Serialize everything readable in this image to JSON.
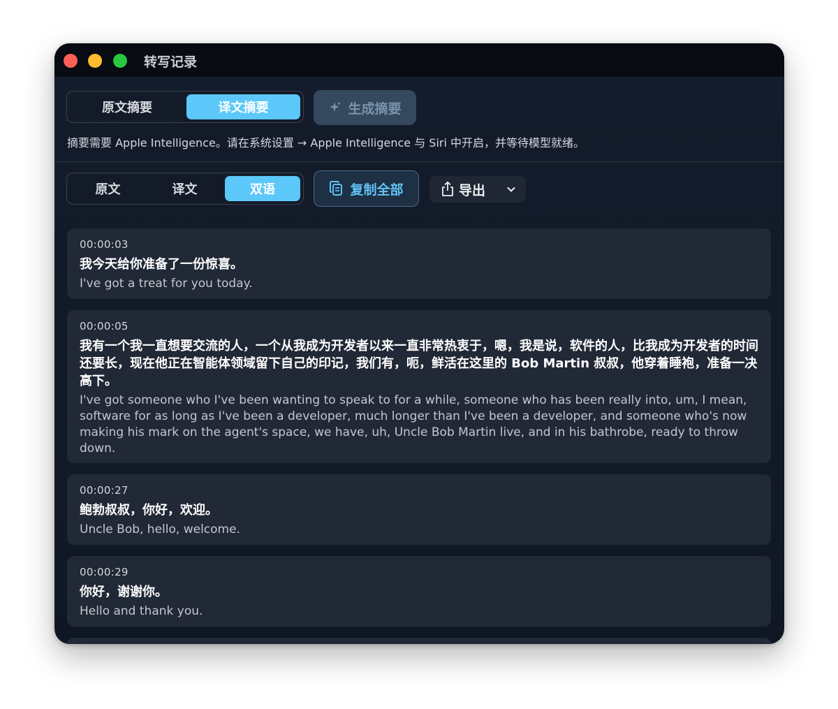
{
  "window": {
    "title": "转写记录"
  },
  "summary_tabs": [
    {
      "label": "原文摘要",
      "active": false
    },
    {
      "label": "译文摘要",
      "active": true
    }
  ],
  "generate_button": {
    "label": "生成摘要",
    "icon": "sparkle-icon",
    "enabled": false
  },
  "hint": "摘要需要 Apple Intelligence。请在系统设置 → Apple Intelligence 与 Siri 中开启，并等待模型就绪。",
  "view_tabs": [
    {
      "label": "原文",
      "active": false
    },
    {
      "label": "译文",
      "active": false
    },
    {
      "label": "双语",
      "active": true
    }
  ],
  "copy_button": {
    "label": "复制全部",
    "icon": "copy-icon"
  },
  "export_button": {
    "label": "导出",
    "icon": "share-icon"
  },
  "entries": [
    {
      "time": "00:00:03",
      "translation": "我今天给你准备了一份惊喜。",
      "original": "I've got a treat for you today."
    },
    {
      "time": "00:00:05",
      "translation": "我有一个我一直想要交流的人，一个从我成为开发者以来一直非常热衷于，嗯，我是说，软件的人，比我成为开发者的时间还要长，现在他正在智能体领域留下自己的印记，我们有，呃，鲜活在这里的 Bob Martin 叔叔，他穿着睡袍，准备一决高下。",
      "original": "I've got someone who I've been wanting to speak to for a while, someone who has been really into, um, I mean, software for as long as I've been a developer, much longer than I've been a developer, and someone who's now making his mark on the agent's space, we have, uh, Uncle Bob Martin live, and in his bathrobe, ready to throw down."
    },
    {
      "time": "00:00:27",
      "translation": "鲍勃叔叔，你好，欢迎。",
      "original": "Uncle Bob, hello, welcome."
    },
    {
      "time": "00:00:29",
      "translation": "你好，谢谢你。",
      "original": "Hello and thank you."
    }
  ],
  "colors": {
    "accent": "#5cc8fa",
    "window_bg": "#121a28",
    "card_bg": "#212836",
    "copy_text": "#62c2f5"
  }
}
